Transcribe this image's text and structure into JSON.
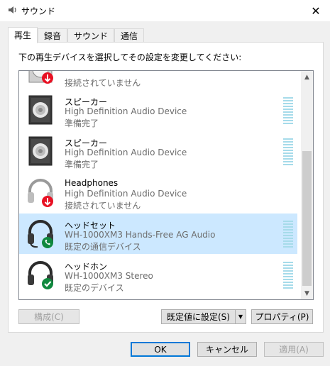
{
  "window": {
    "title": "サウンド",
    "close_glyph": "✕"
  },
  "tabs": [
    {
      "label": "再生",
      "active": true
    },
    {
      "label": "録音",
      "active": false
    },
    {
      "label": "サウンド",
      "active": false
    },
    {
      "label": "通信",
      "active": false
    }
  ],
  "instruction": "下の再生デバイスを選択してその設定を変更してください:",
  "devices": [
    {
      "name": "",
      "description": "",
      "status": "接続されていません",
      "icon": "speaker-disconnected-icon",
      "selected": false
    },
    {
      "name": "スピーカー",
      "description": "High Definition Audio Device",
      "status": "準備完了",
      "icon": "speaker-icon",
      "selected": false
    },
    {
      "name": "スピーカー",
      "description": "High Definition Audio Device",
      "status": "準備完了",
      "icon": "speaker-icon",
      "selected": false
    },
    {
      "name": "Headphones",
      "description": "High Definition Audio Device",
      "status": "接続されていません",
      "icon": "headphones-disconnected-icon",
      "selected": false
    },
    {
      "name": "ヘッドセット",
      "description": "WH-1000XM3 Hands-Free AG Audio",
      "status": "既定の通信デバイス",
      "icon": "headset-default-comm-icon",
      "selected": true
    },
    {
      "name": "ヘッドホン",
      "description": "WH-1000XM3 Stereo",
      "status": "既定のデバイス",
      "icon": "headphones-default-icon",
      "selected": false
    }
  ],
  "buttons": {
    "configure": "構成(C)",
    "set_default": "既定値に設定(S)",
    "properties": "プロパティ(P)",
    "ok": "OK",
    "cancel": "キャンセル",
    "apply": "適用(A)"
  },
  "colors": {
    "selection": "#cce8ff",
    "level_meter": "#a6dbea",
    "accent": "#0078d7",
    "disconnected_badge": "#e81123",
    "default_badge": "#10893e"
  }
}
